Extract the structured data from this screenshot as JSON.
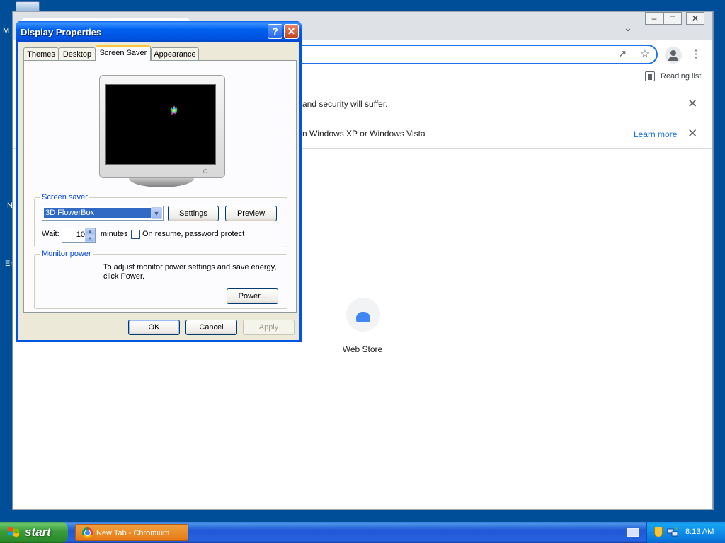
{
  "desktop": {
    "icon_labels": [
      "M",
      "N",
      "Er"
    ]
  },
  "chromium": {
    "reading_list": "Reading list",
    "infobar1": "and security will suffer.",
    "infobar2": "n Windows XP or Windows Vista",
    "learn_more": "Learn more",
    "web_store": "Web Store"
  },
  "dialog": {
    "title": "Display Properties",
    "tabs": [
      "Themes",
      "Desktop",
      "Screen Saver",
      "Appearance"
    ],
    "active_tab": "Screen Saver",
    "screen_saver": {
      "group_label": "Screen saver",
      "selected": "3D FlowerBox",
      "settings_button": "Settings",
      "preview_button": "Preview",
      "wait_label": "Wait:",
      "wait_value": "10",
      "minutes_label": "minutes",
      "password_protect_label": "On resume, password protect",
      "password_protect_checked": false
    },
    "monitor_power": {
      "group_label": "Monitor power",
      "description": "To adjust monitor power settings and save energy, click Power.",
      "power_button": "Power..."
    },
    "ok_button": "OK",
    "cancel_button": "Cancel",
    "apply_button": "Apply"
  },
  "taskbar": {
    "start_label": "start",
    "task_label": "New Tab - Chromium",
    "clock": "8:13 AM"
  },
  "colors": {
    "desktop": "#004e98",
    "titlebar_blue": "#0054e3",
    "dialog_face": "#ece9d8",
    "selection": "#316ac5",
    "link_blue": "#1a73e8",
    "task_orange": "#e57b15",
    "start_green": "#3a9c3a"
  },
  "icons": [
    "computer-icon",
    "help-icon",
    "close-icon",
    "minimize-icon",
    "restore-icon",
    "share-icon",
    "star-icon",
    "profile-icon",
    "menu-icon",
    "reading-list-icon",
    "chevron-down-icon",
    "web-store-icon",
    "windows-flag-icon",
    "chromium-icon",
    "keyboard-icon",
    "security-shield-icon",
    "network-icon"
  ]
}
